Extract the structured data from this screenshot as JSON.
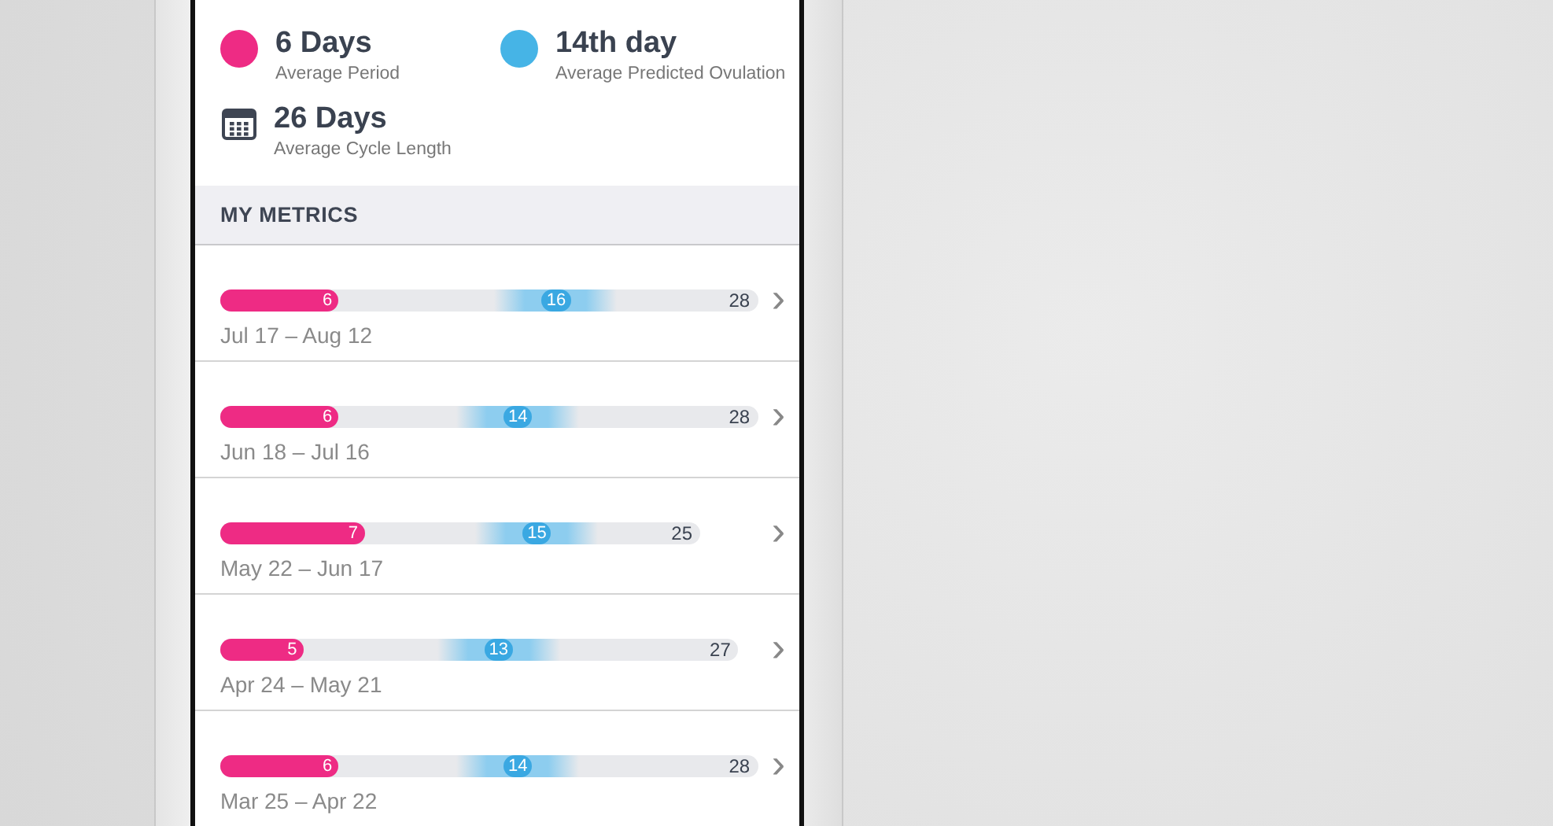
{
  "summary": [
    {
      "kind": "dot",
      "color": "#ee2b84",
      "value": "6 Days",
      "label": "Average Period"
    },
    {
      "kind": "dot",
      "color": "#46b4e6",
      "value": "14th day",
      "label": "Average Predicted Ovulation"
    },
    {
      "kind": "calendar",
      "value": "26 Days",
      "label": "Average Cycle Length"
    }
  ],
  "section_title": "MY METRICS",
  "cycles": [
    {
      "total": "28",
      "period": {
        "label": "6",
        "level": 0.22
      },
      "ovulation": {
        "label": "16"
      },
      "dates": "Jul 17 – Aug 12",
      "chevron": "›"
    },
    {
      "total": "28",
      "period": {
        "label": "6",
        "level": 0.22
      },
      "ovulation": {
        "label": "14"
      },
      "dates": "Jun 18 – Jul 16",
      "chevron": "›"
    },
    {
      "total": "25",
      "period": {
        "label": "7",
        "level": 0.3
      },
      "ovulation": {
        "label": "15"
      },
      "dates": "May 22 – Jun 17",
      "chevron": "›"
    },
    {
      "total": "27",
      "period": {
        "label": "5",
        "level": 0.16
      },
      "ovulation": {
        "label": "13"
      },
      "dates": "Apr 24 – May 21",
      "chevron": "›"
    },
    {
      "total": "28",
      "period": {
        "label": "6",
        "level": 0.22
      },
      "ovulation": {
        "label": "14"
      },
      "dates": "Mar 25 – Apr 22",
      "chevron": "›"
    }
  ]
}
